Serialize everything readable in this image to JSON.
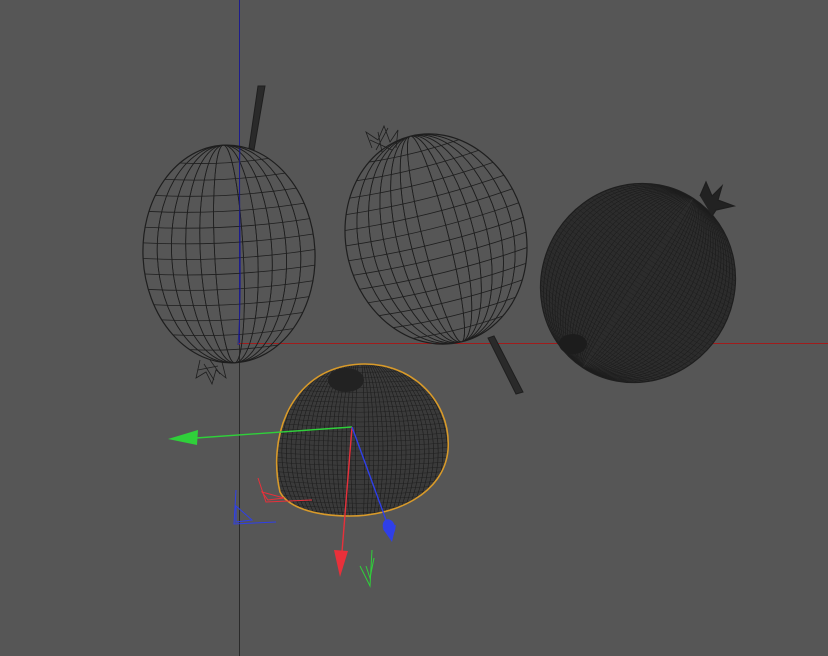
{
  "viewport": {
    "mode": "wireframe",
    "selected_object": "fruit-half-cut",
    "colors": {
      "background": "#565656",
      "wire": "#1e1e1e",
      "selection": "#d89a2a",
      "x_axis": "#e8303a",
      "y_axis": "#2fd03a",
      "z_axis": "#2f3fe8",
      "world_x": "#a01c1c",
      "world_z": "#1c1c8c",
      "world_y": "#2a2a2a"
    }
  },
  "objects": [
    {
      "name": "fruit-stem-up",
      "shading": "wireframe-sparse"
    },
    {
      "name": "fruit-stem-down",
      "shading": "wireframe-sparse"
    },
    {
      "name": "fruit-dense",
      "shading": "wireframe-dense"
    },
    {
      "name": "fruit-half-cut",
      "shading": "wireframe-dense",
      "selected": true
    }
  ],
  "gizmo": {
    "axes": [
      "x",
      "y",
      "z"
    ],
    "handles": [
      "x-arrow",
      "y-arrow",
      "z-arrow",
      "xy-plane",
      "yz-plane",
      "xz-plane"
    ]
  }
}
